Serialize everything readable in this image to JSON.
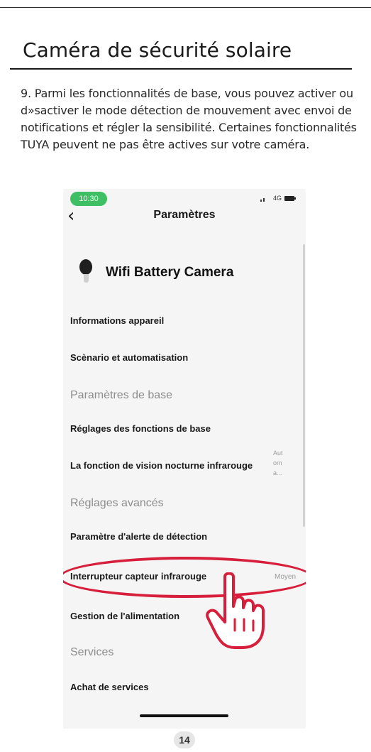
{
  "section": {
    "title": "Caméra de sécurité solaire"
  },
  "instructions": "9. Parmi les fonctionnalités de base, vous pouvez activer ou d»sactiver le mode détection de mouvement avec envoi de notifications et régler la sensibilité. Certaines fonctionnalités TUYA peuvent ne pas être actives sur votre caméra.",
  "phone": {
    "status": {
      "time": "10:30",
      "network": "4G"
    },
    "nav_title": "Paramètres",
    "device_name": "Wifi Battery Camera",
    "rows": {
      "device_info": "Informations appareil",
      "scenario": "Scènario et automatisation",
      "basic_header": "Paramètres de base",
      "basic_functions": "Réglages des fonctions de base",
      "night_vision": "La fonction de vision nocturne infrarouge",
      "night_vision_value": [
        "Aut",
        "om",
        "a..."
      ],
      "advanced_header": "Réglages avancés",
      "detection_alert": "Paramètre d'alerte de détection",
      "infrared_sensor": "Interrupteur capteur infrarouge",
      "infrared_sensor_value": "Moyen",
      "power_management": "Gestion de l'alimentation",
      "services_header": "Services",
      "purchase_services": "Achat de services"
    }
  },
  "page_number": "14",
  "colors": {
    "highlight": "#d71e3a",
    "status_green": "#3fbf63"
  },
  "icons": {
    "back": "chevron-left-icon",
    "camera": "camera-icon",
    "pointer": "pointing-hand-icon"
  }
}
